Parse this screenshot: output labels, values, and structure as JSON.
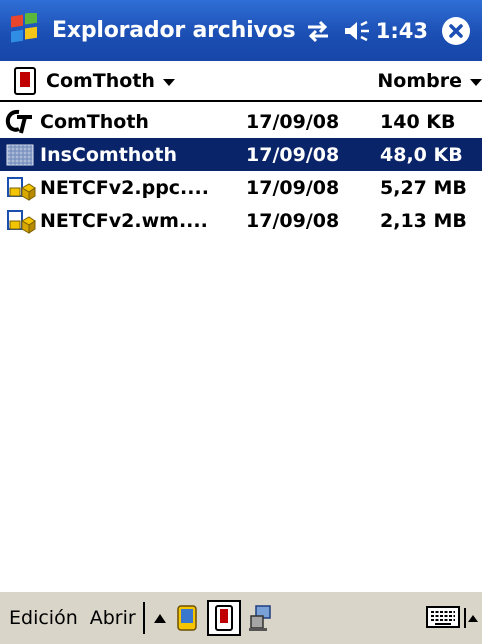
{
  "titlebar": {
    "title": "Explorador archivos",
    "time": "1:43",
    "icons": [
      "windows-flag-icon",
      "connectivity-icon",
      "volume-icon",
      "close-icon"
    ]
  },
  "folderbar": {
    "folder_name": "ComThoth",
    "sort_label": "Nombre"
  },
  "files": [
    {
      "name": "ComThoth",
      "date": "17/09/08",
      "size": "140 KB",
      "icon": "comthoth-app-icon",
      "selected": false
    },
    {
      "name": "InsComthoth",
      "date": "17/09/08",
      "size": "48,0 KB",
      "icon": "generic-file-icon",
      "selected": true
    },
    {
      "name": "NETCFv2.ppc....",
      "date": "17/09/08",
      "size": "5,27 MB",
      "icon": "cab-package-icon",
      "selected": false
    },
    {
      "name": "NETCFv2.wm....",
      "date": "17/09/08",
      "size": "2,13 MB",
      "icon": "cab-package-icon",
      "selected": false
    }
  ],
  "menubar": {
    "edit_label": "Edición",
    "open_label": "Abrir",
    "icons": [
      "up-folder-icon",
      "main-memory-icon",
      "storage-card-icon",
      "network-share-icon",
      "keyboard-icon",
      "sip-arrow-icon"
    ]
  },
  "colors": {
    "title_bar": "#1c4fb4",
    "selection": "#0a246a",
    "menu_bar": "#d9d5c9"
  }
}
